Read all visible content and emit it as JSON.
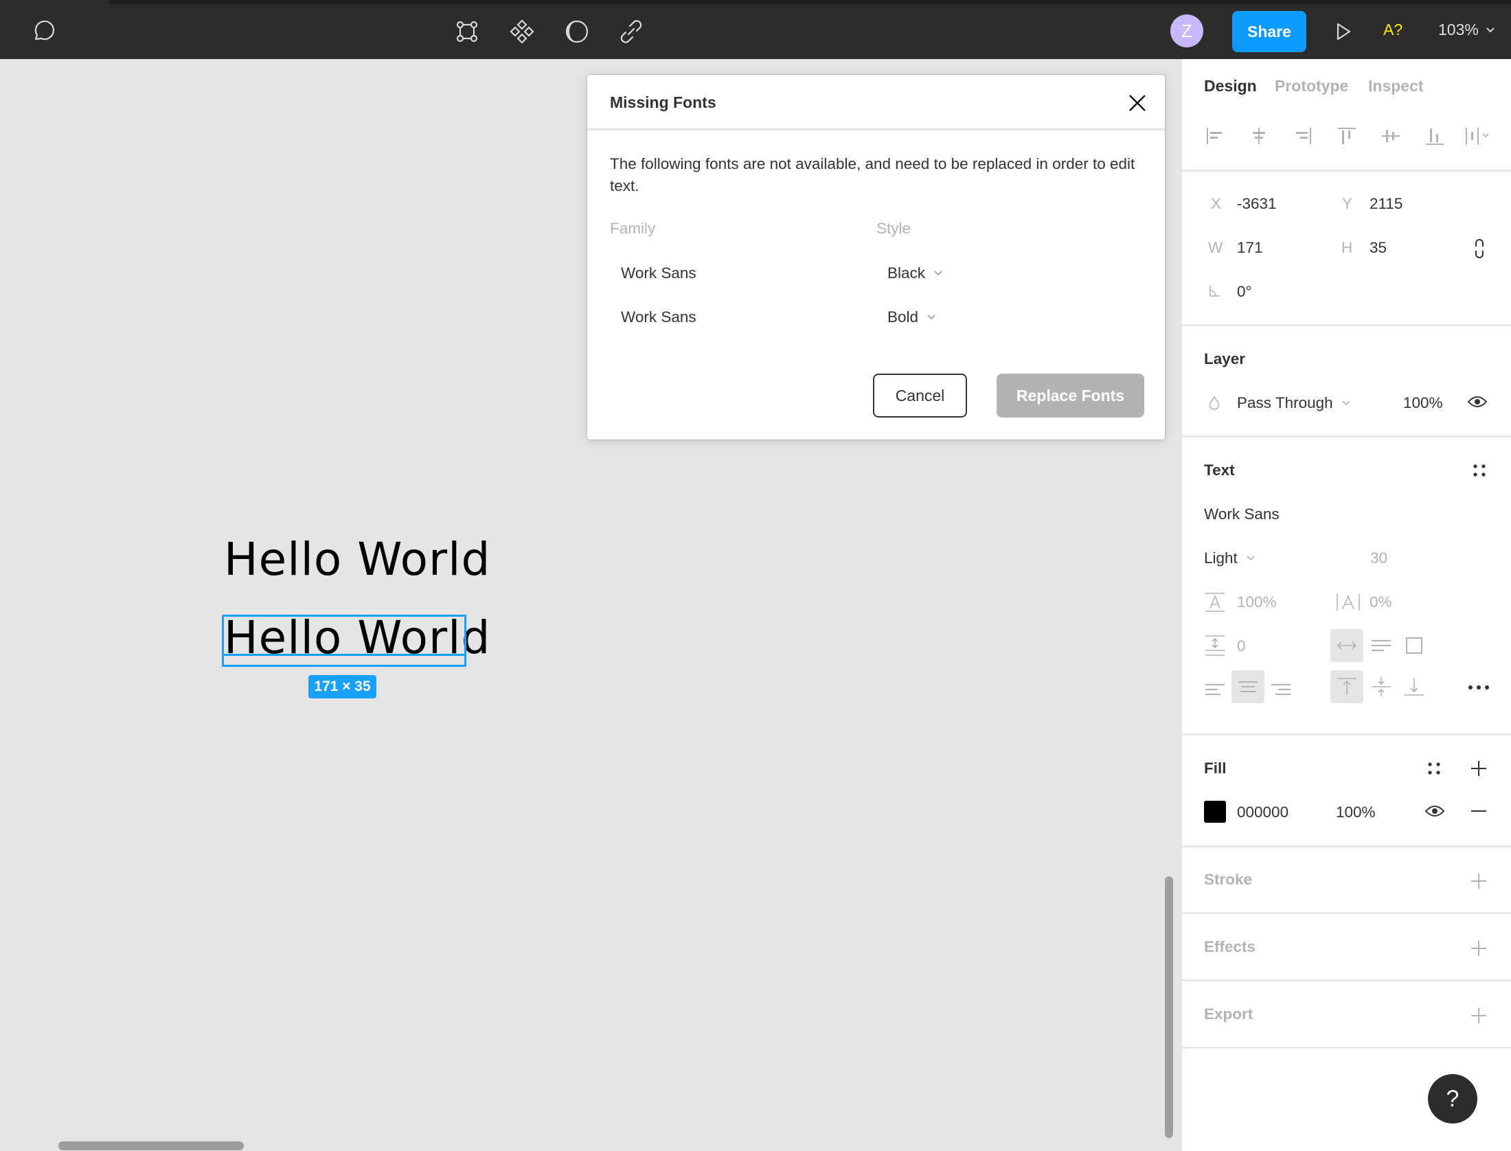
{
  "toolbar": {
    "left_icons": [
      "comment-icon"
    ],
    "center_icons": [
      "frame-tool-icon",
      "components-icon",
      "mask-contrast-icon",
      "link-icon"
    ],
    "avatar_initial": "Z",
    "avatar_color": "#c7b9fc",
    "share_label": "Share",
    "share_color": "#0d99ff",
    "present_icon": "play-icon",
    "missing_fonts_indicator": "A?",
    "missing_fonts_color": "#ffeb00",
    "zoom_level": "103%"
  },
  "canvas": {
    "texts": [
      "Hello World",
      "Hello World"
    ],
    "selection_size_badge": "171 × 35",
    "selection_color": "#18a0fb"
  },
  "dialog": {
    "title": "Missing Fonts",
    "description": "The following fonts are not available, and need to be replaced in order to edit text.",
    "columns": {
      "family": "Family",
      "style": "Style"
    },
    "rows": [
      {
        "family": "Work Sans",
        "style": "Black"
      },
      {
        "family": "Work Sans",
        "style": "Bold"
      }
    ],
    "cancel_label": "Cancel",
    "replace_label": "Replace Fonts"
  },
  "panel": {
    "tabs": [
      {
        "label": "Design",
        "active": true
      },
      {
        "label": "Prototype",
        "active": false
      },
      {
        "label": "Inspect",
        "active": false
      }
    ],
    "align_icons": [
      "align-left-icon",
      "align-horizontal-center-icon",
      "align-right-icon",
      "align-top-icon",
      "align-vertical-center-icon",
      "align-bottom-icon",
      "distribute-icon"
    ],
    "geometry": {
      "x_label": "X",
      "x": "-3631",
      "y_label": "Y",
      "y": "2115",
      "w_label": "W",
      "w": "171",
      "h_label": "H",
      "h": "35",
      "rotation": "0°"
    },
    "layer": {
      "title": "Layer",
      "blend_mode": "Pass Through",
      "opacity": "100%"
    },
    "text": {
      "title": "Text",
      "font_family": "Work Sans",
      "font_style": "Light",
      "font_size": "30",
      "line_height": "100%",
      "letter_spacing": "0%",
      "paragraph_spacing": "0"
    },
    "fill": {
      "title": "Fill",
      "color_hex": "000000",
      "swatch": "#000000",
      "opacity": "100%"
    },
    "stroke": {
      "title": "Stroke"
    },
    "effects": {
      "title": "Effects"
    },
    "export": {
      "title": "Export"
    },
    "help_label": "?"
  }
}
